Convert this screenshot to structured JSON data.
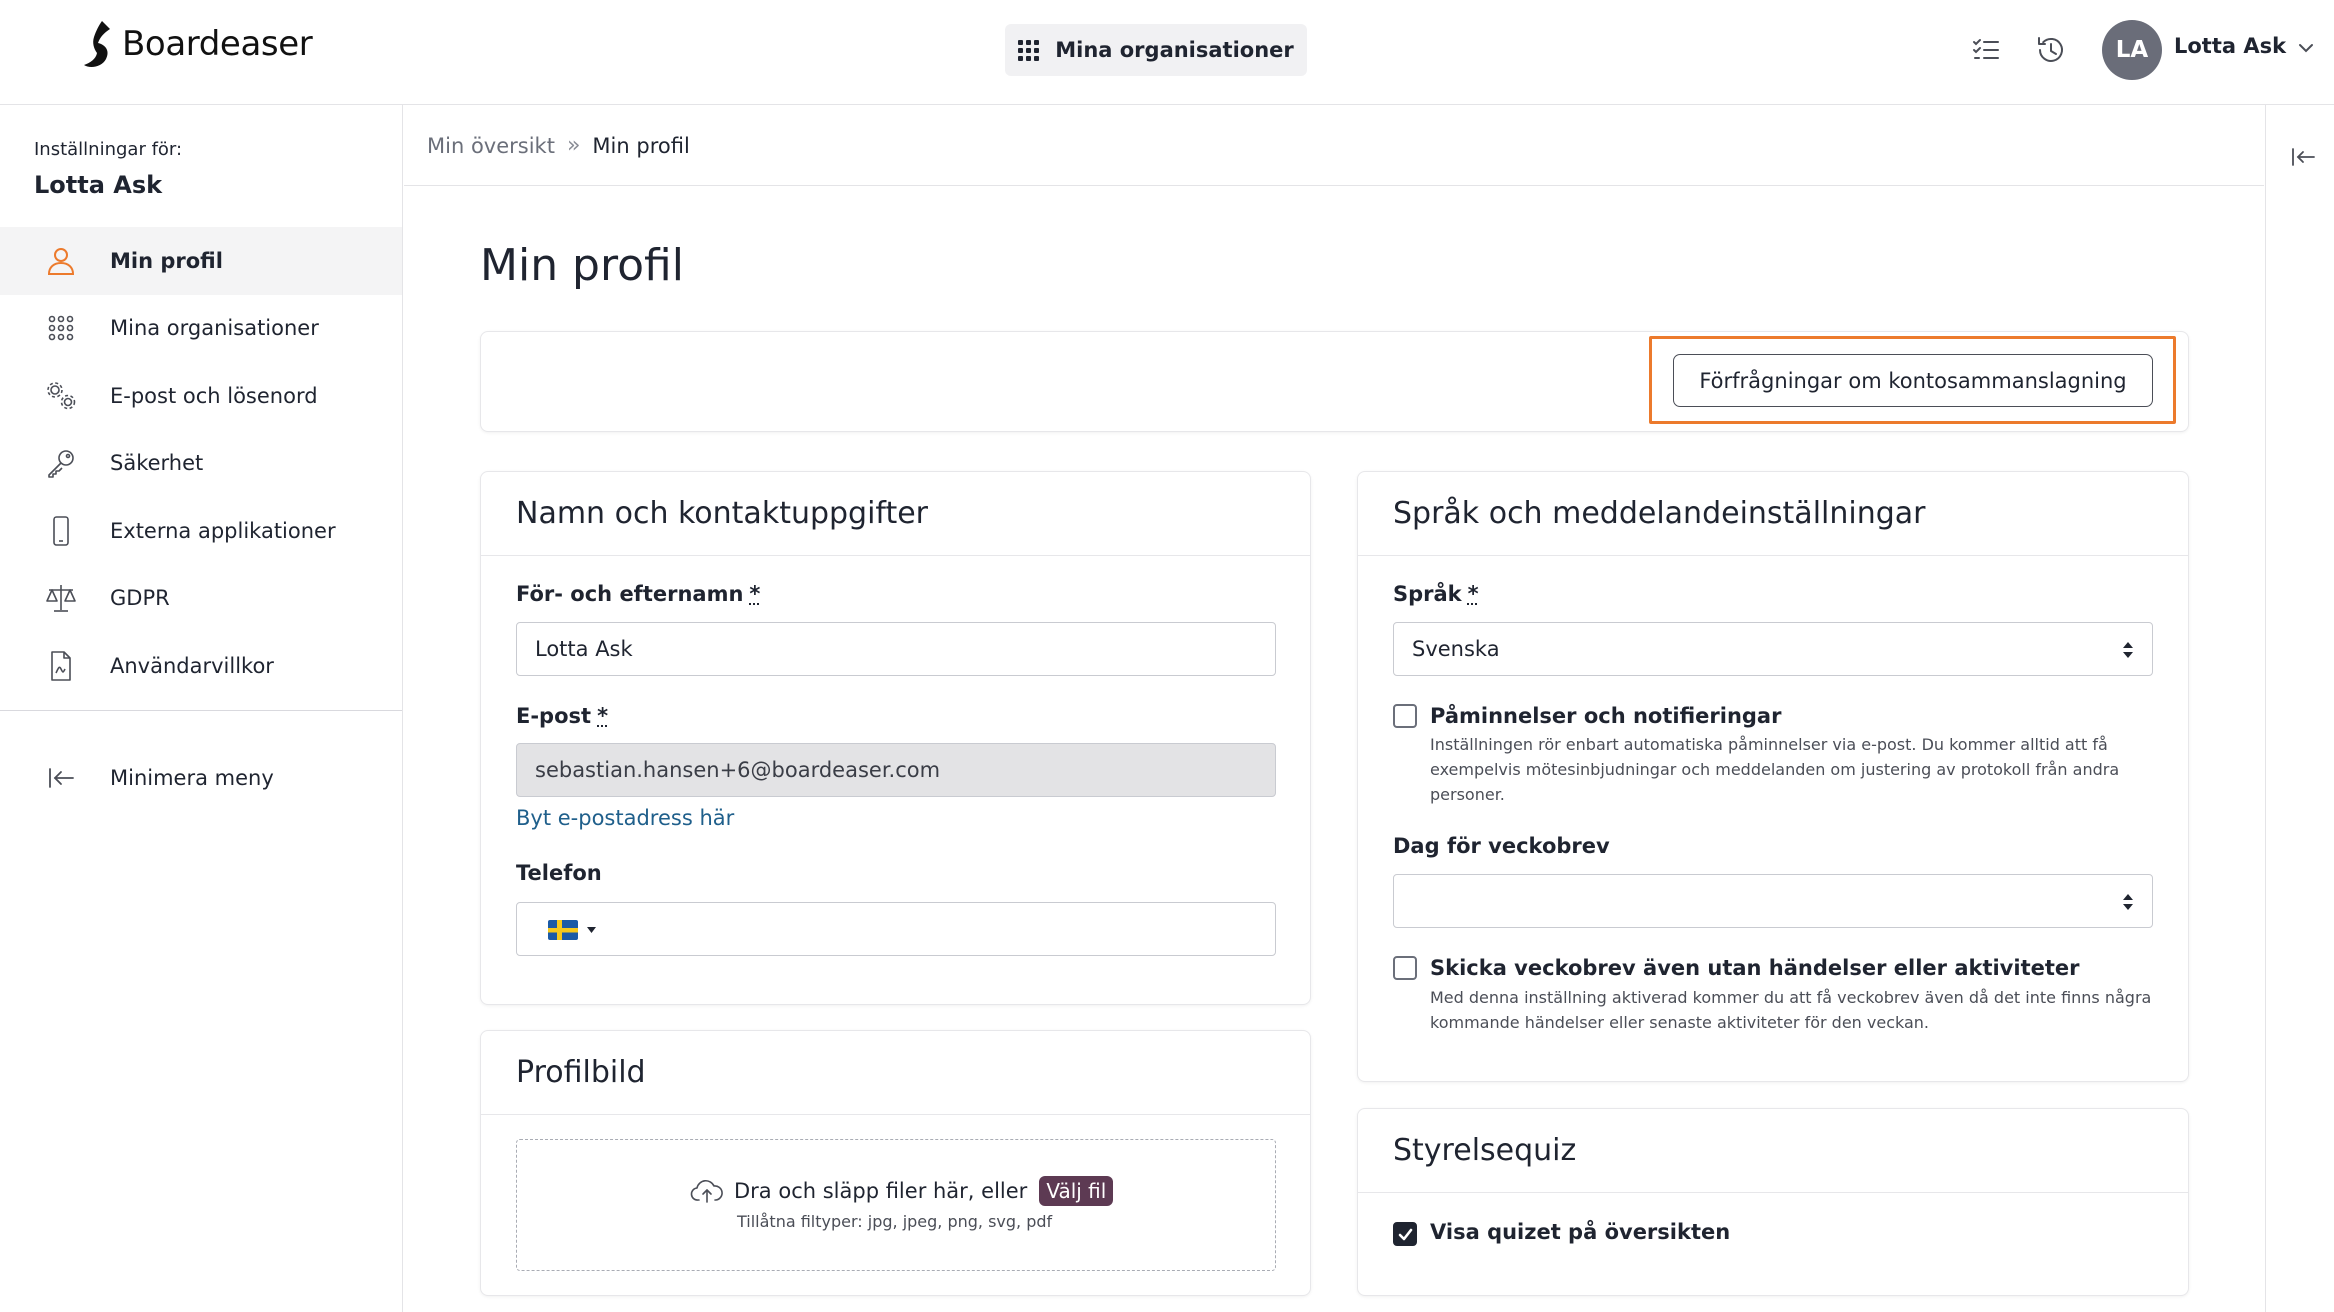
{
  "brand": {
    "name": "Boardeaser"
  },
  "header": {
    "org_button_label": "Mina organisationer",
    "avatar_initials": "LA",
    "user_name": "Lotta Ask",
    "icons": [
      "tasks-icon",
      "history-icon",
      "chevron-down-icon"
    ]
  },
  "sidebar": {
    "settings_for": "Inställningar för:",
    "user_name": "Lotta Ask",
    "items": [
      {
        "label": "Min profil",
        "icon": "user-icon",
        "active": true
      },
      {
        "label": "Mina organisationer",
        "icon": "grid-icon",
        "active": false
      },
      {
        "label": "E-post och lösenord",
        "icon": "gears-icon",
        "active": false
      },
      {
        "label": "Säkerhet",
        "icon": "key-icon",
        "active": false
      },
      {
        "label": "Externa applikationer",
        "icon": "phone-icon",
        "active": false
      },
      {
        "label": "GDPR",
        "icon": "scale-icon",
        "active": false
      },
      {
        "label": "Användarvillkor",
        "icon": "document-icon",
        "active": false
      }
    ],
    "minimize_label": "Minimera meny"
  },
  "breadcrumb": {
    "parent": "Min översikt",
    "separator": "»",
    "current": "Min profil"
  },
  "page": {
    "title": "Min profil",
    "merge_button_label": "Förfrågningar om kontosammanslagning"
  },
  "contact": {
    "title": "Namn och kontaktuppgifter",
    "name_label": "För- och efternamn",
    "name_value": "Lotta Ask",
    "email_label": "E-post",
    "email_value": "sebastian.hansen+6@boardeaser.com",
    "change_email_link": "Byt e-postadress här",
    "phone_label": "Telefon",
    "phone_value": "",
    "required_marker": "*"
  },
  "profile_picture": {
    "title": "Profilbild",
    "drop_text": "Dra och släpp filer här, eller",
    "choose_file": "Välj fil",
    "allowed_types": "Tillåtna filtyper: jpg, jpeg, png, svg, pdf"
  },
  "language": {
    "title": "Språk och meddelandeinställningar",
    "language_label": "Språk",
    "language_value": "Svenska",
    "reminders_label": "Påminnelser och notifieringar",
    "reminders_checked": false,
    "reminders_help_1": "Inställningen rör enbart automatiska påminnelser via e-post. Du kommer alltid att få",
    "reminders_help_2": "exempelvis mötesinbjudningar och meddelanden om justering av protokoll från andra",
    "reminders_help_3": "personer.",
    "weekly_day_label": "Dag för veckobrev",
    "weekly_day_value": "",
    "send_weekly_label": "Skicka veckobrev även utan händelser eller aktiviteter",
    "send_weekly_checked": false,
    "send_weekly_help_1": "Med denna inställning aktiverad kommer du att få veckobrev även då det inte finns några",
    "send_weekly_help_2": "kommande händelser eller senaste aktiviteter för den veckan."
  },
  "quiz": {
    "title": "Styrelsequiz",
    "show_quiz_label": "Visa quizet på översikten",
    "show_quiz_checked": true
  },
  "colors": {
    "highlight_outline": "#ec7a2c",
    "link": "#1f5f8b",
    "choose_file_bg": "#5d3a53",
    "active_nav_icon": "#ec7a2c",
    "avatar_bg": "#6a6d79"
  }
}
